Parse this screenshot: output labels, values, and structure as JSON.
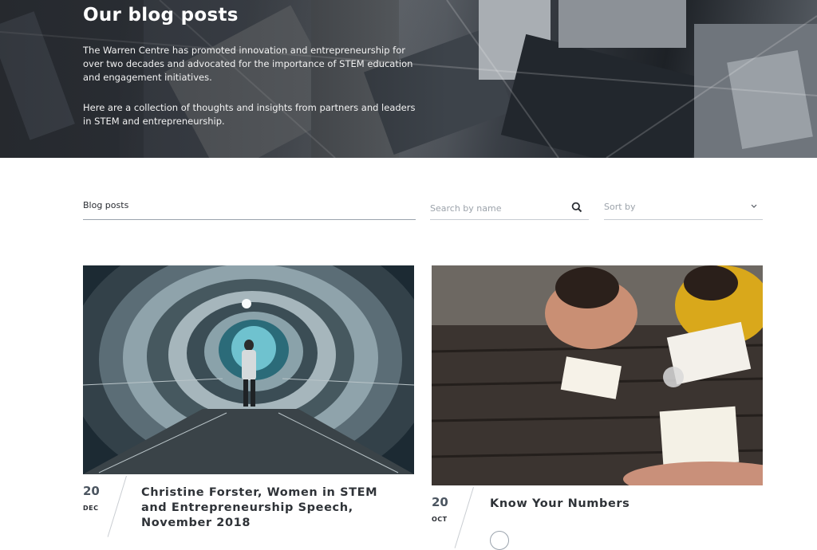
{
  "hero": {
    "title": "Our blog posts",
    "paragraph1": "The Warren Centre has promoted innovation and entrepreneurship for over two decades and advocated for the importance of STEM education and engagement initiatives.",
    "paragraph2": "Here are a collection of thoughts and insights from partners and leaders in STEM and entrepreneurship."
  },
  "filters": {
    "category_label": "Blog posts",
    "search_placeholder": "Search by name",
    "sort_label": "Sort by"
  },
  "posts": [
    {
      "day": "20",
      "month": "DEC",
      "title": "Christine Forster, Women in STEM and Entrepreneurship Speech, November 2018",
      "image": "tunnel-photo"
    },
    {
      "day": "20",
      "month": "OCT",
      "title": "Know Your Numbers",
      "image": "students-photo"
    }
  ],
  "colors": {
    "text_dark": "#2f3338",
    "muted": "#9ca3ab",
    "line": "#9aa3ad"
  }
}
